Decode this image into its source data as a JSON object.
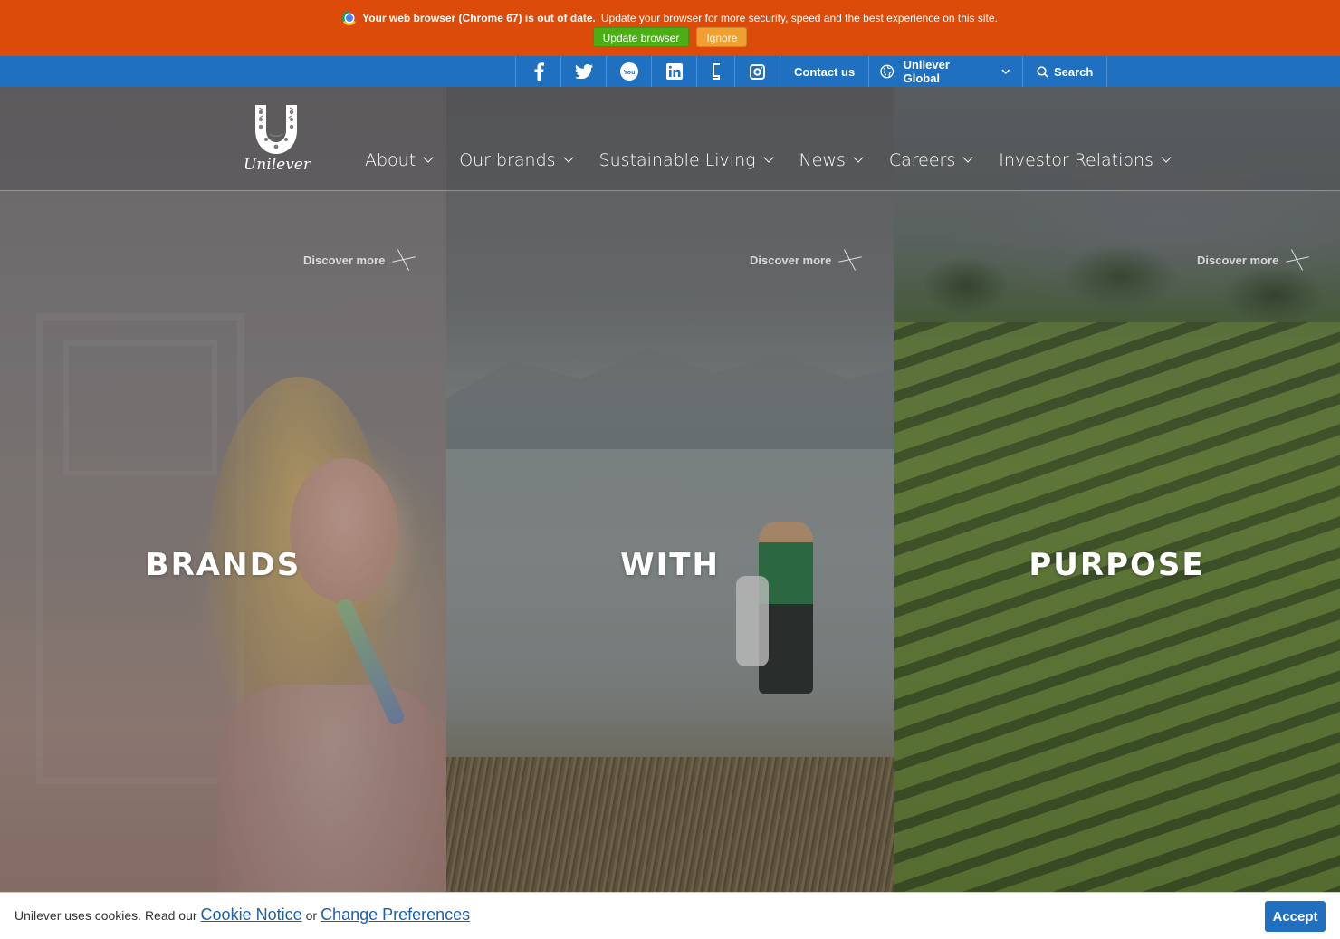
{
  "update_banner": {
    "bold_text": "Your web browser (Chrome 67) is out of date.",
    "text": "Update your browser for more security, speed and the best experience on this site.",
    "update_label": "Update browser",
    "ignore_label": "Ignore"
  },
  "utility_bar": {
    "social_icons": [
      "facebook-icon",
      "twitter-icon",
      "youtube-icon",
      "linkedin-icon",
      "glassdoor-icon",
      "instagram-icon"
    ],
    "contact_label": "Contact us",
    "region_label": "Unilever Global",
    "search_label": "Search"
  },
  "main_nav": {
    "logo_text": "Unilever",
    "items": [
      {
        "label": "About"
      },
      {
        "label": "Our brands"
      },
      {
        "label": "Sustainable Living"
      },
      {
        "label": "News"
      },
      {
        "label": "Careers"
      },
      {
        "label": "Investor Relations"
      }
    ]
  },
  "hero": {
    "panels": [
      {
        "word": "BRANDS",
        "discover": "Discover more"
      },
      {
        "word": "WITH",
        "discover": "Discover more"
      },
      {
        "word": "PURPOSE",
        "discover": "Discover more"
      }
    ]
  },
  "cookie_bar": {
    "text_before": "Unilever uses cookies. Read our",
    "cookie_notice": "Cookie Notice",
    "or": "or",
    "change_prefs": "Change Preferences",
    "accept": "Accept"
  },
  "colors": {
    "banner": "#dd4b0a",
    "utility_bar": "#1f70c1",
    "update_button": "#4cae15",
    "ignore_button": "#f0a030"
  }
}
